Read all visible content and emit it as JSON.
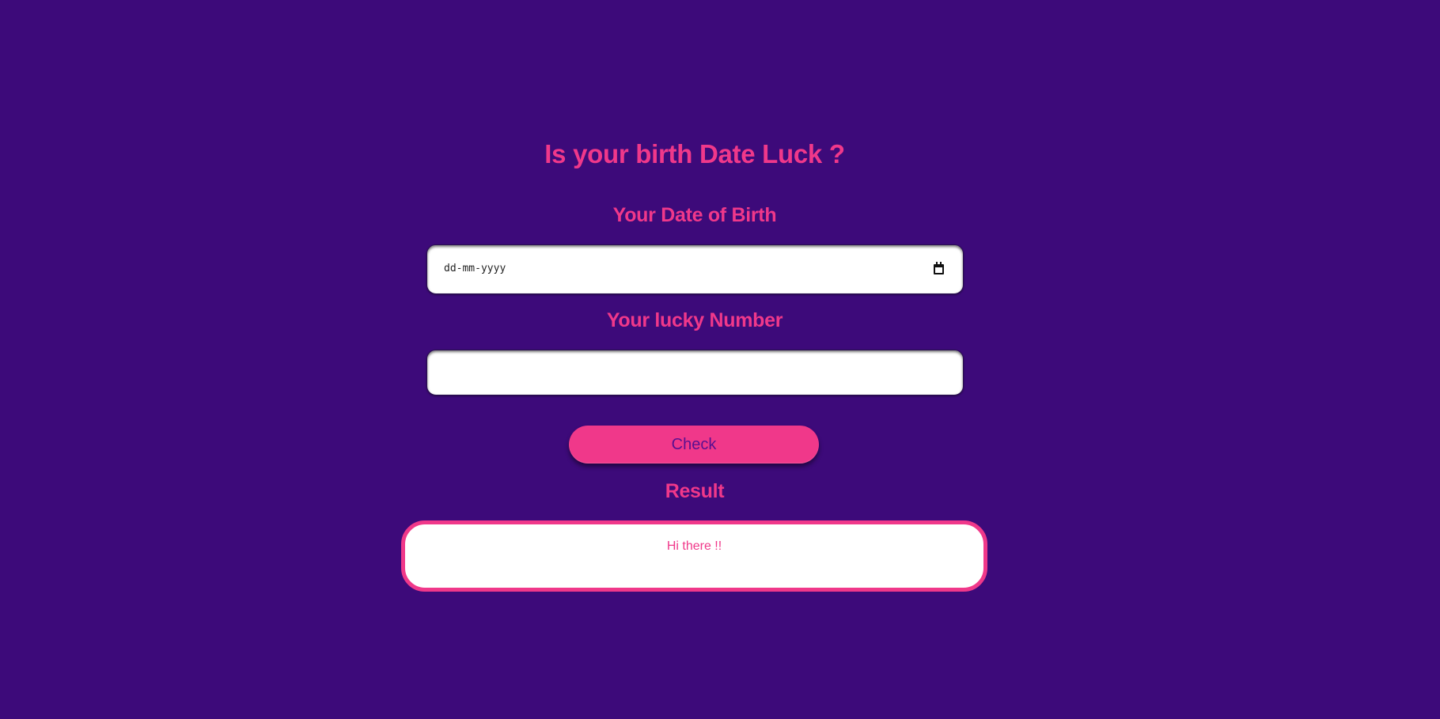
{
  "page": {
    "title": "Is your birth Date Luck ?"
  },
  "form": {
    "dob_label": "Your Date of Birth",
    "dob_placeholder": "dd-mm-yyyy",
    "dob_icon": "calendar-icon",
    "lucky_label": "Your lucky Number",
    "lucky_value": "",
    "check_label": "Check"
  },
  "result": {
    "label": "Result",
    "message": "Hi there !!"
  },
  "colors": {
    "background": "#3d0a7a",
    "accent": "#f0388a",
    "button_text": "#5a1090",
    "field_bg": "#ffffff"
  }
}
